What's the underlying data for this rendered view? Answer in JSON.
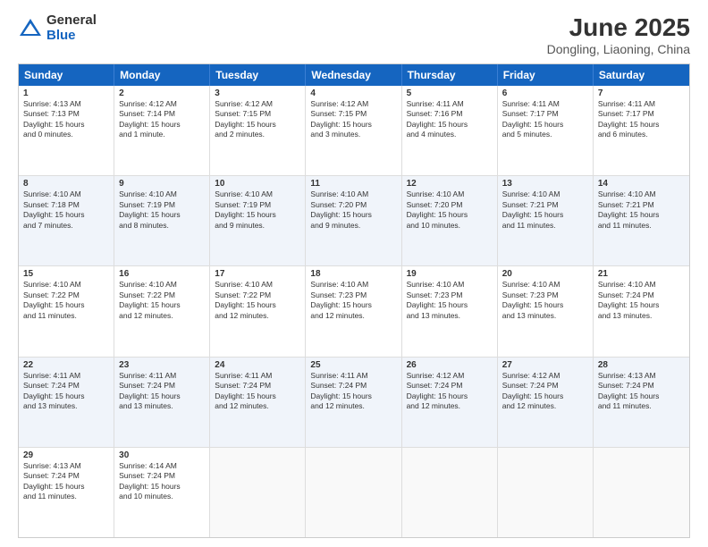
{
  "logo": {
    "general": "General",
    "blue": "Blue"
  },
  "title": "June 2025",
  "subtitle": "Dongling, Liaoning, China",
  "headers": [
    "Sunday",
    "Monday",
    "Tuesday",
    "Wednesday",
    "Thursday",
    "Friday",
    "Saturday"
  ],
  "rows": [
    [
      {
        "day": "",
        "text": ""
      },
      {
        "day": "2",
        "text": "Sunrise: 4:12 AM\nSunset: 7:14 PM\nDaylight: 15 hours\nand 1 minute."
      },
      {
        "day": "3",
        "text": "Sunrise: 4:12 AM\nSunset: 7:15 PM\nDaylight: 15 hours\nand 2 minutes."
      },
      {
        "day": "4",
        "text": "Sunrise: 4:12 AM\nSunset: 7:15 PM\nDaylight: 15 hours\nand 3 minutes."
      },
      {
        "day": "5",
        "text": "Sunrise: 4:11 AM\nSunset: 7:16 PM\nDaylight: 15 hours\nand 4 minutes."
      },
      {
        "day": "6",
        "text": "Sunrise: 4:11 AM\nSunset: 7:17 PM\nDaylight: 15 hours\nand 5 minutes."
      },
      {
        "day": "7",
        "text": "Sunrise: 4:11 AM\nSunset: 7:17 PM\nDaylight: 15 hours\nand 6 minutes."
      }
    ],
    [
      {
        "day": "8",
        "text": "Sunrise: 4:10 AM\nSunset: 7:18 PM\nDaylight: 15 hours\nand 7 minutes."
      },
      {
        "day": "9",
        "text": "Sunrise: 4:10 AM\nSunset: 7:19 PM\nDaylight: 15 hours\nand 8 minutes."
      },
      {
        "day": "10",
        "text": "Sunrise: 4:10 AM\nSunset: 7:19 PM\nDaylight: 15 hours\nand 9 minutes."
      },
      {
        "day": "11",
        "text": "Sunrise: 4:10 AM\nSunset: 7:20 PM\nDaylight: 15 hours\nand 9 minutes."
      },
      {
        "day": "12",
        "text": "Sunrise: 4:10 AM\nSunset: 7:20 PM\nDaylight: 15 hours\nand 10 minutes."
      },
      {
        "day": "13",
        "text": "Sunrise: 4:10 AM\nSunset: 7:21 PM\nDaylight: 15 hours\nand 11 minutes."
      },
      {
        "day": "14",
        "text": "Sunrise: 4:10 AM\nSunset: 7:21 PM\nDaylight: 15 hours\nand 11 minutes."
      }
    ],
    [
      {
        "day": "15",
        "text": "Sunrise: 4:10 AM\nSunset: 7:22 PM\nDaylight: 15 hours\nand 11 minutes."
      },
      {
        "day": "16",
        "text": "Sunrise: 4:10 AM\nSunset: 7:22 PM\nDaylight: 15 hours\nand 12 minutes."
      },
      {
        "day": "17",
        "text": "Sunrise: 4:10 AM\nSunset: 7:22 PM\nDaylight: 15 hours\nand 12 minutes."
      },
      {
        "day": "18",
        "text": "Sunrise: 4:10 AM\nSunset: 7:23 PM\nDaylight: 15 hours\nand 12 minutes."
      },
      {
        "day": "19",
        "text": "Sunrise: 4:10 AM\nSunset: 7:23 PM\nDaylight: 15 hours\nand 13 minutes."
      },
      {
        "day": "20",
        "text": "Sunrise: 4:10 AM\nSunset: 7:23 PM\nDaylight: 15 hours\nand 13 minutes."
      },
      {
        "day": "21",
        "text": "Sunrise: 4:10 AM\nSunset: 7:24 PM\nDaylight: 15 hours\nand 13 minutes."
      }
    ],
    [
      {
        "day": "22",
        "text": "Sunrise: 4:11 AM\nSunset: 7:24 PM\nDaylight: 15 hours\nand 13 minutes."
      },
      {
        "day": "23",
        "text": "Sunrise: 4:11 AM\nSunset: 7:24 PM\nDaylight: 15 hours\nand 13 minutes."
      },
      {
        "day": "24",
        "text": "Sunrise: 4:11 AM\nSunset: 7:24 PM\nDaylight: 15 hours\nand 12 minutes."
      },
      {
        "day": "25",
        "text": "Sunrise: 4:11 AM\nSunset: 7:24 PM\nDaylight: 15 hours\nand 12 minutes."
      },
      {
        "day": "26",
        "text": "Sunrise: 4:12 AM\nSunset: 7:24 PM\nDaylight: 15 hours\nand 12 minutes."
      },
      {
        "day": "27",
        "text": "Sunrise: 4:12 AM\nSunset: 7:24 PM\nDaylight: 15 hours\nand 12 minutes."
      },
      {
        "day": "28",
        "text": "Sunrise: 4:13 AM\nSunset: 7:24 PM\nDaylight: 15 hours\nand 11 minutes."
      }
    ],
    [
      {
        "day": "29",
        "text": "Sunrise: 4:13 AM\nSunset: 7:24 PM\nDaylight: 15 hours\nand 11 minutes."
      },
      {
        "day": "30",
        "text": "Sunrise: 4:14 AM\nSunset: 7:24 PM\nDaylight: 15 hours\nand 10 minutes."
      },
      {
        "day": "",
        "text": ""
      },
      {
        "day": "",
        "text": ""
      },
      {
        "day": "",
        "text": ""
      },
      {
        "day": "",
        "text": ""
      },
      {
        "day": "",
        "text": ""
      }
    ]
  ],
  "first_row": {
    "day1": {
      "day": "1",
      "text": "Sunrise: 4:13 AM\nSunset: 7:13 PM\nDaylight: 15 hours\nand 0 minutes."
    }
  }
}
